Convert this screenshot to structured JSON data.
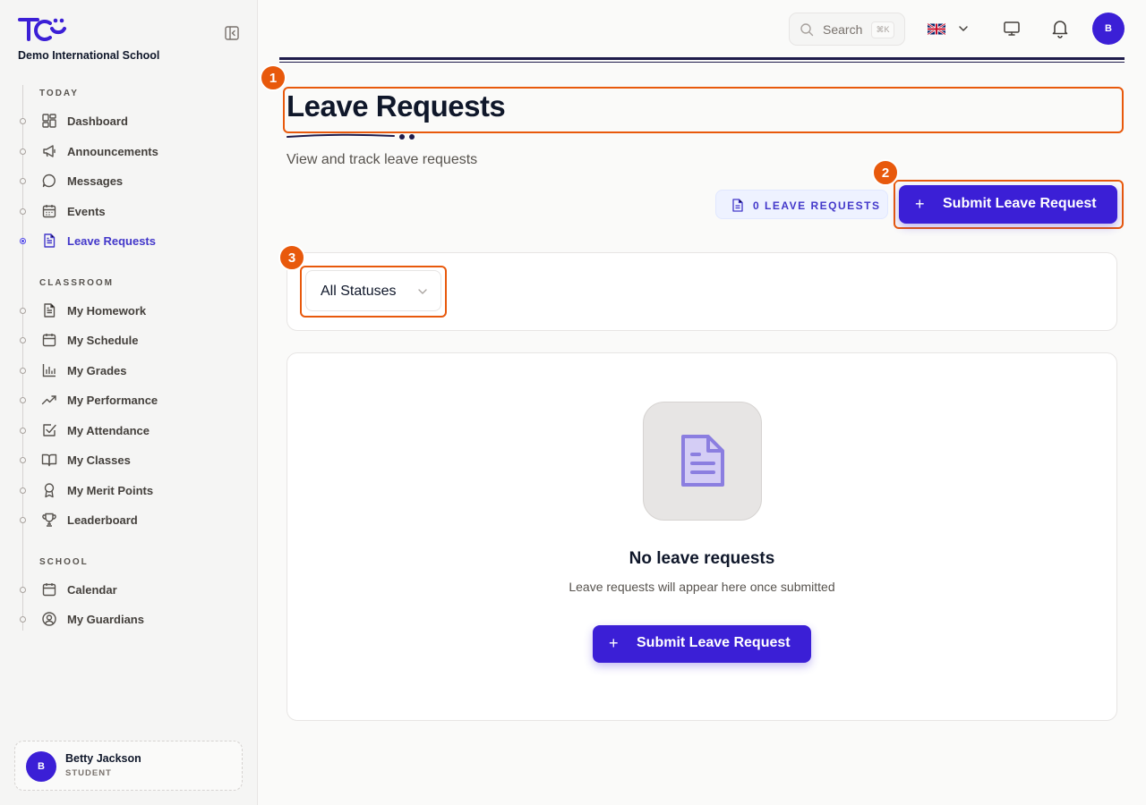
{
  "sidebar": {
    "school_name": "Demo International School",
    "sections": {
      "today": "TODAY",
      "classroom": "CLASSROOM",
      "school": "SCHOOL"
    },
    "items": [
      {
        "label": "Dashboard",
        "icon": "dashboard-icon"
      },
      {
        "label": "Announcements",
        "icon": "megaphone-icon"
      },
      {
        "label": "Messages",
        "icon": "message-icon"
      },
      {
        "label": "Events",
        "icon": "calendar-icon"
      },
      {
        "label": "Leave Requests",
        "icon": "document-icon",
        "active": true
      },
      {
        "label": "My Homework",
        "icon": "document-icon"
      },
      {
        "label": "My Schedule",
        "icon": "calendar-icon"
      },
      {
        "label": "My Grades",
        "icon": "bar-chart-icon"
      },
      {
        "label": "My Performance",
        "icon": "trending-up-icon"
      },
      {
        "label": "My Attendance",
        "icon": "checkbox-icon"
      },
      {
        "label": "My Classes",
        "icon": "book-icon"
      },
      {
        "label": "My Merit Points",
        "icon": "award-icon"
      },
      {
        "label": "Leaderboard",
        "icon": "trophy-icon"
      },
      {
        "label": "Calendar",
        "icon": "calendar-icon"
      },
      {
        "label": "My Guardians",
        "icon": "user-circle-icon"
      }
    ],
    "user": {
      "initial": "B",
      "name": "Betty Jackson",
      "role": "STUDENT"
    }
  },
  "topbar": {
    "search_placeholder": "Search",
    "search_shortcut": "⌘K",
    "avatar_initial": "B"
  },
  "markers": [
    "1",
    "2",
    "3"
  ],
  "main": {
    "title": "Leave Requests",
    "subtitle": "View and track leave requests",
    "count_badge": "0 LEAVE REQUESTS",
    "submit_label": "Submit Leave Request",
    "plus": "+",
    "status_filter": "All Statuses",
    "empty": {
      "title": "No leave requests",
      "description": "Leave requests will appear here once submitted",
      "button_label": "Submit Leave Request"
    }
  },
  "colors": {
    "accent": "#3b1fd6",
    "marker": "#e8590c"
  }
}
